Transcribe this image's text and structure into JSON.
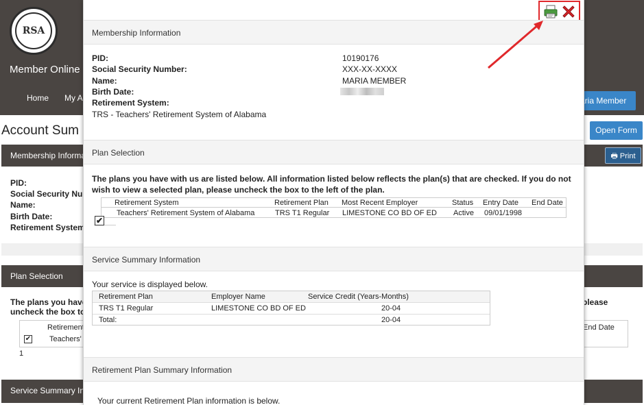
{
  "background": {
    "site_title": "Member Online",
    "nav": {
      "home": "Home",
      "my": "My A"
    },
    "user_button": "aria Member",
    "page_title": "Account Sum",
    "open_form": "Open Form",
    "print": "Print",
    "membership_head": "Membership Informa",
    "labels": [
      "PID:",
      "Social Security Num",
      "Name:",
      "Birth Date:",
      "Retirement System"
    ],
    "plan_selection_head": "Plan Selection",
    "plans_text_line1": "The plans you have",
    "plans_text_line2": "uncheck the box to",
    "plans_text_right": "please",
    "table_head_left": "Retirement",
    "table_head_right": "End Date",
    "table_cell_left": "Teachers' F",
    "row_count": "1",
    "service_head": "Service Summary Inf"
  },
  "modal": {
    "membership": {
      "heading": "Membership Information",
      "pid_label": "PID:",
      "pid_value": "10190176",
      "ssn_label": "Social Security Number:",
      "ssn_value": "XXX-XX-XXXX",
      "name_label": "Name:",
      "name_value": "MARIA MEMBER",
      "birth_label": "Birth Date:",
      "system_label": "Retirement System:",
      "system_value": "TRS - Teachers' Retirement System of Alabama"
    },
    "plan_selection": {
      "heading": "Plan Selection",
      "paragraph": "The plans you have with us are listed below. All information listed below reflects the plan(s) that are checked. If you do not wish to view a selected plan, please uncheck the box to the left of the plan.",
      "columns": [
        "Retirement System",
        "Retirement Plan",
        "Most Recent Employer",
        "Status",
        "Entry Date",
        "End Date"
      ],
      "row": [
        "Teachers' Retirement System of Alabama",
        "TRS T1 Regular",
        "LIMESTONE CO BD OF ED",
        "Active",
        "09/01/1998",
        ""
      ],
      "checkbox_mark": "✔"
    },
    "service_summary": {
      "heading": "Service Summary Information",
      "note": "Your service is displayed below.",
      "columns": [
        "Retirement Plan",
        "Employer Name",
        "Service Credit (Years-Months)"
      ],
      "row": [
        "TRS T1 Regular",
        "LIMESTONE CO BD OF ED",
        "20-04"
      ],
      "total_label": "Total:",
      "total_value": "20-04"
    },
    "retirement_plan_summary": {
      "heading": "Retirement Plan Summary Information",
      "note": "Your current Retirement Plan information is below."
    }
  },
  "colors": {
    "header_dark": "#4a4542",
    "accent_blue": "#3a86c8",
    "highlight_red": "#e0282b"
  },
  "icons": [
    "rsa-logo",
    "printer-icon",
    "close-icon",
    "annotation-arrow"
  ]
}
